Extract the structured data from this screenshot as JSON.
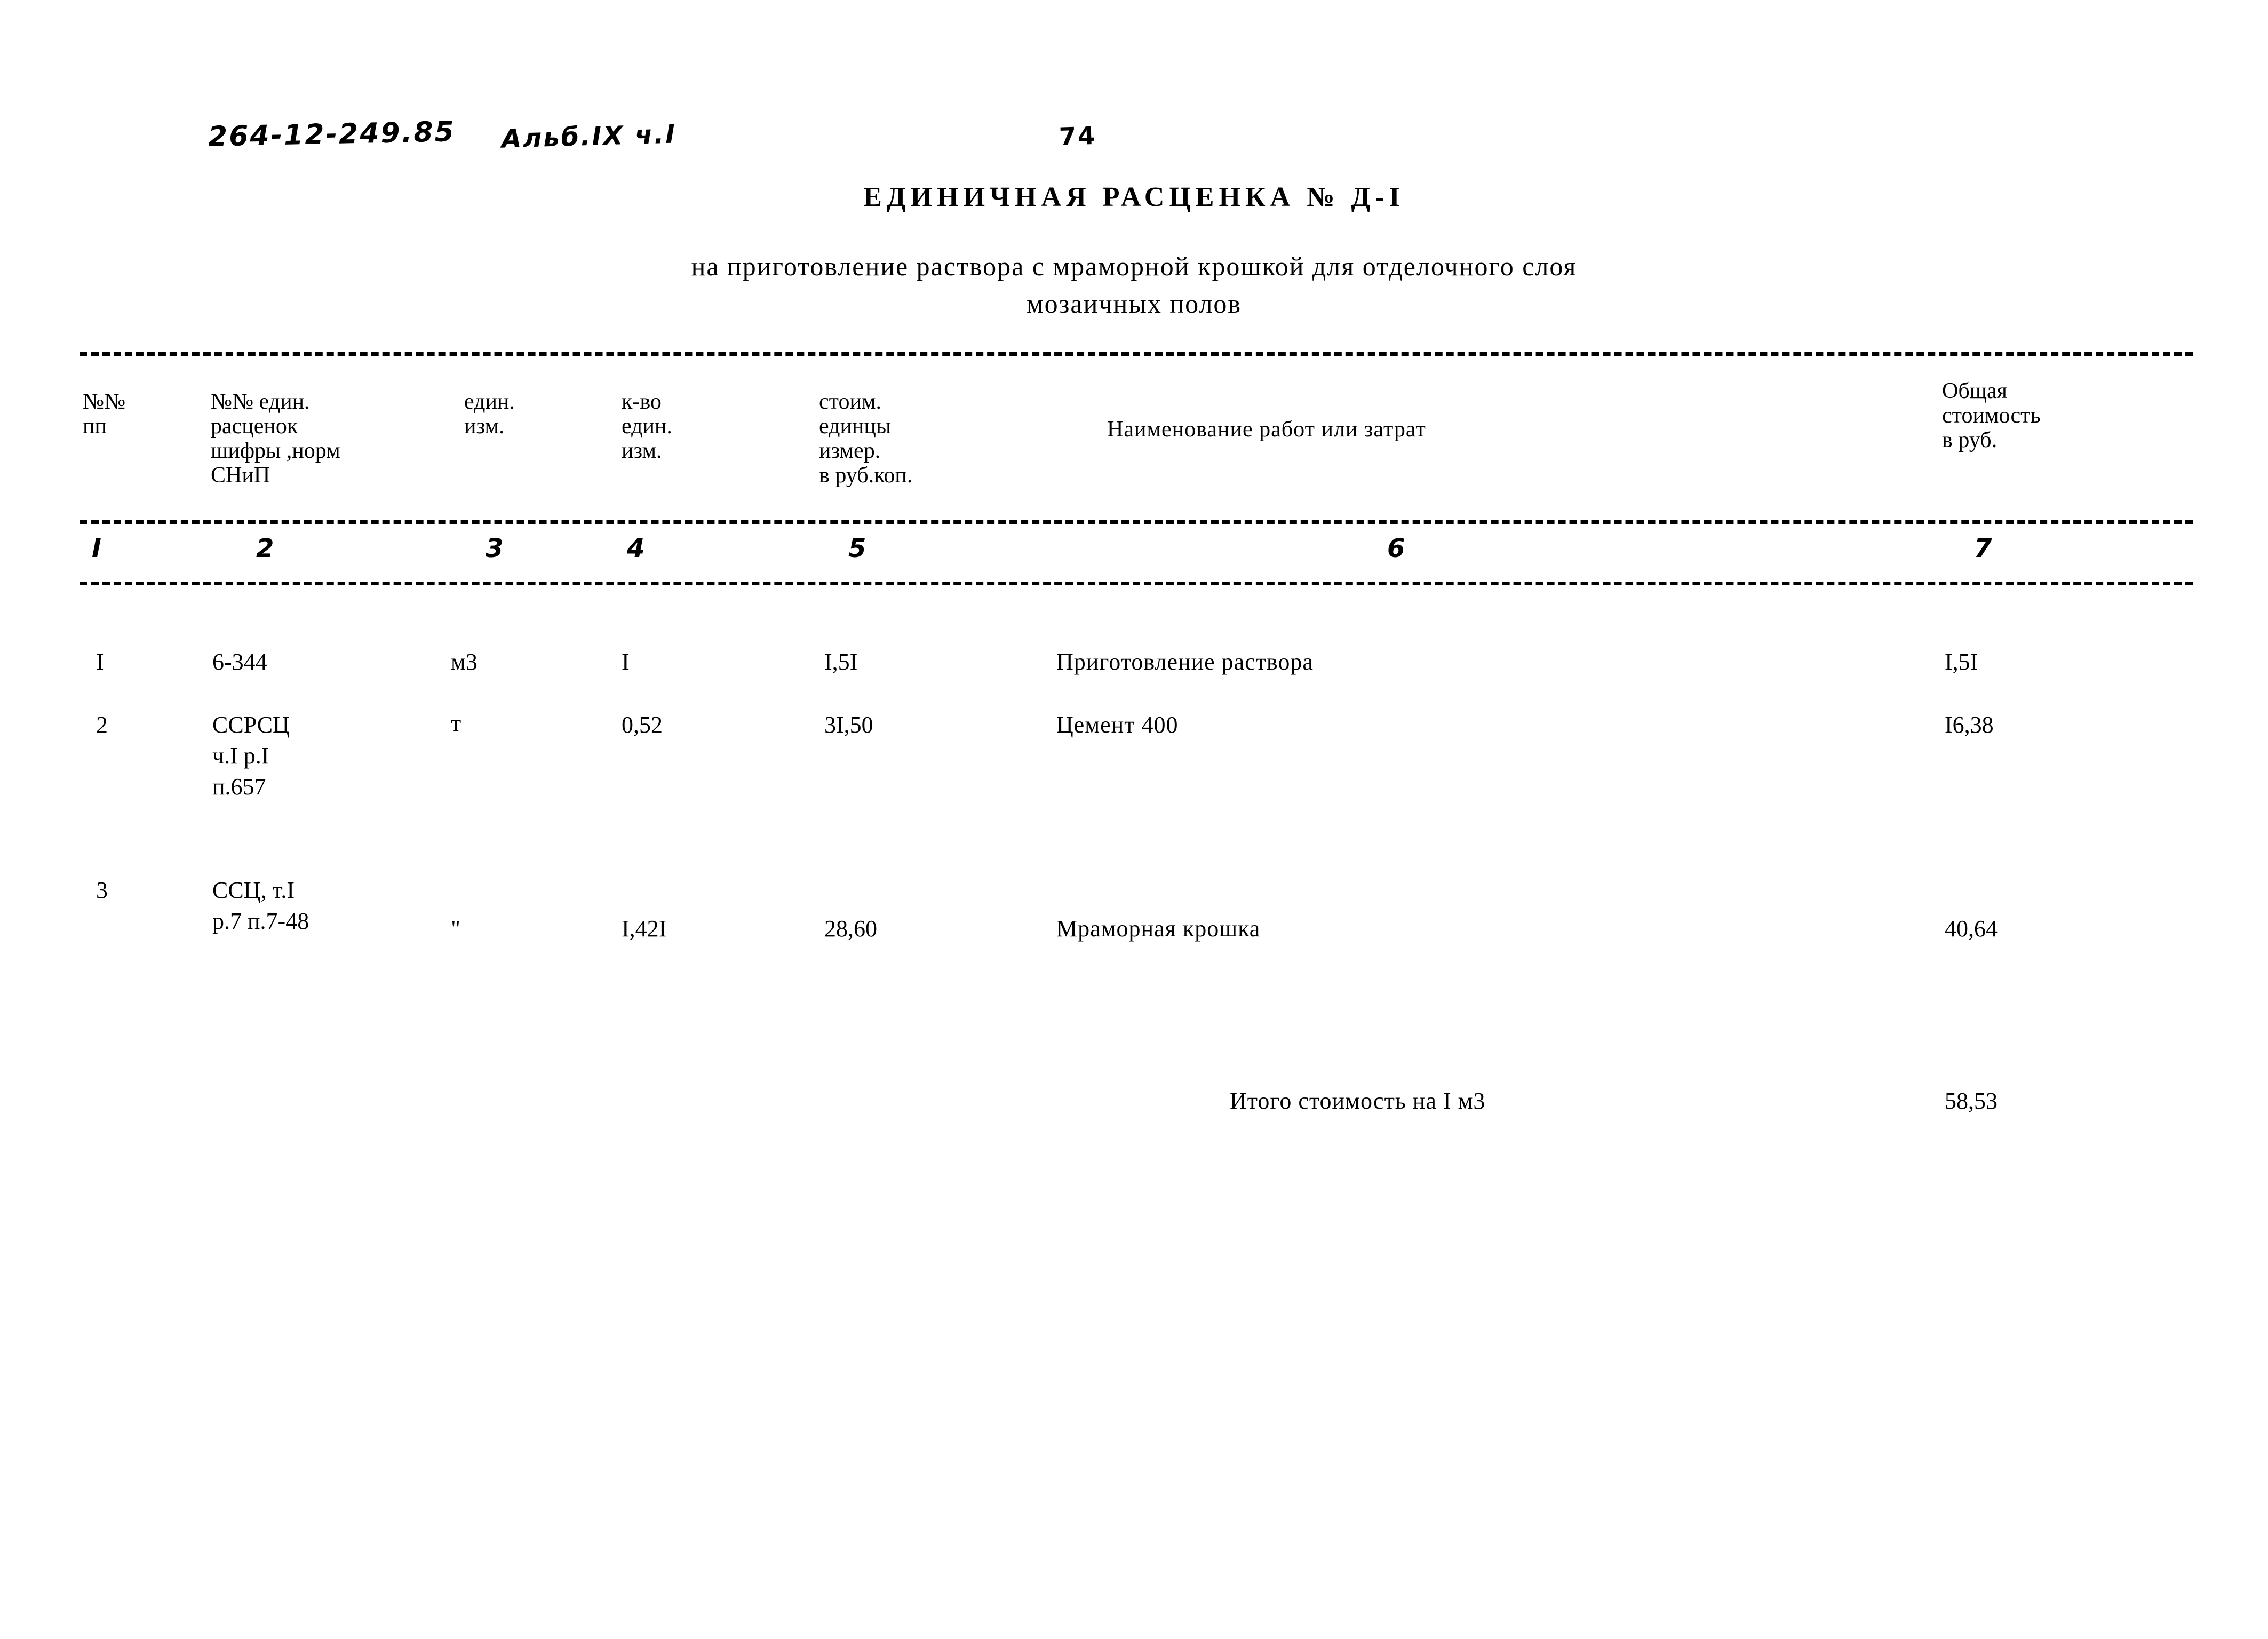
{
  "annotations": {
    "document_code": "264-12-249.85",
    "album_ref": "Альб.IX ч.I",
    "page_number": "74"
  },
  "title": {
    "main": "ЕДИНИЧНАЯ  РАСЦЕНКА  № Д-I",
    "subtitle_line1": "на приготовление раствора  с мраморной крошкой  для отделочного слоя",
    "subtitle_line2": "мозаичных полов"
  },
  "table": {
    "headers": [
      "№№\nпп",
      "№№ един.\nрасценок\nшифры ,норм\nСНиП",
      "един.\nизм.",
      "к-во\nедин.\nизм.",
      "стоим.\nединцы\nизмер.\nв руб.коп.",
      "Наименование  работ или затрат",
      "Общая\nстоимость\nв руб."
    ],
    "column_numbers": [
      "I",
      "2",
      "3",
      "4",
      "5",
      "6",
      "7"
    ],
    "rows": [
      {
        "num": "I",
        "code": "6-344",
        "unit": "м3",
        "qty": "I",
        "unit_price": "I,5I",
        "name": "Приготовление  раствора",
        "total": "I,5I"
      },
      {
        "num": "2",
        "code": "ССРСЦ\nч.I р.I\nп.657",
        "unit": "т",
        "qty": "0,52",
        "unit_price": "3I,50",
        "name": "Цемент  400",
        "total": "I6,38"
      },
      {
        "num": "3",
        "code": "ССЦ, т.I\nр.7 п.7-48",
        "unit": "\"",
        "qty": "I,42I",
        "unit_price": "28,60",
        "name": "Мраморная  крошка",
        "total": "40,64"
      }
    ],
    "total_row": {
      "label": "Итого стоимость  на I м3",
      "value": "58,53"
    }
  }
}
